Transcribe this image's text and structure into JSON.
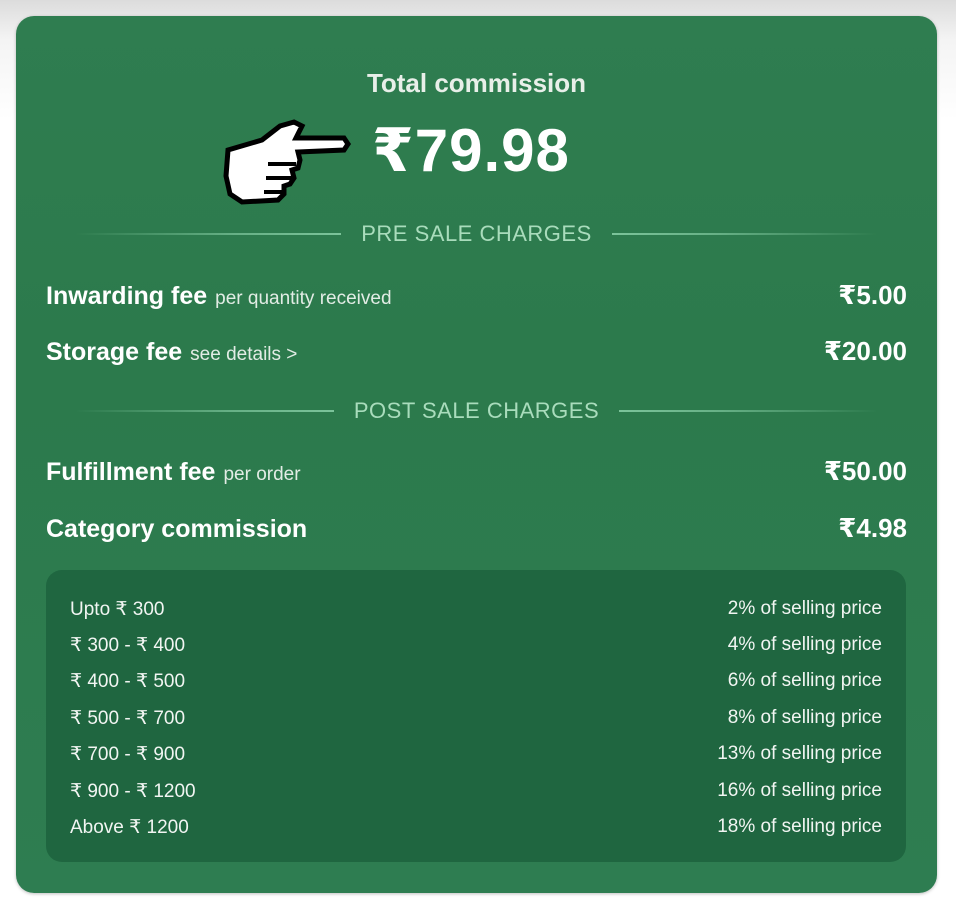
{
  "commission": {
    "title": "Total commission",
    "amount": "₹79.98"
  },
  "pre_sale": {
    "heading": "PRE SALE CHARGES",
    "items": [
      {
        "name": "Inwarding fee",
        "note": "per quantity received",
        "value": "₹5.00"
      },
      {
        "name": "Storage fee",
        "note": "see details >",
        "value": "₹20.00"
      }
    ]
  },
  "post_sale": {
    "heading": "POST SALE CHARGES",
    "items": [
      {
        "name": "Fulfillment fee",
        "note": "per order",
        "value": "₹50.00"
      },
      {
        "name": "Category commission",
        "note": "",
        "value": "₹4.98"
      }
    ]
  },
  "slabs": [
    {
      "range": "Upto ₹ 300",
      "rate": "2% of selling price"
    },
    {
      "range": "₹ 300 - ₹ 400",
      "rate": "4% of selling price"
    },
    {
      "range": "₹ 400 - ₹ 500",
      "rate": "6% of selling price"
    },
    {
      "range": "₹ 500 - ₹ 700",
      "rate": "8% of selling price"
    },
    {
      "range": "₹ 700 - ₹ 900",
      "rate": "13% of selling price"
    },
    {
      "range": "₹ 900 - ₹ 1200",
      "rate": "16% of selling price"
    },
    {
      "range": "Above ₹ 1200",
      "rate": "18% of selling price"
    }
  ],
  "icons": {
    "pointer": "pointing-hand-icon"
  },
  "colors": {
    "card": "#2e7d51",
    "slab_box": "#1f6640",
    "divider_text": "#a9dcbc"
  }
}
